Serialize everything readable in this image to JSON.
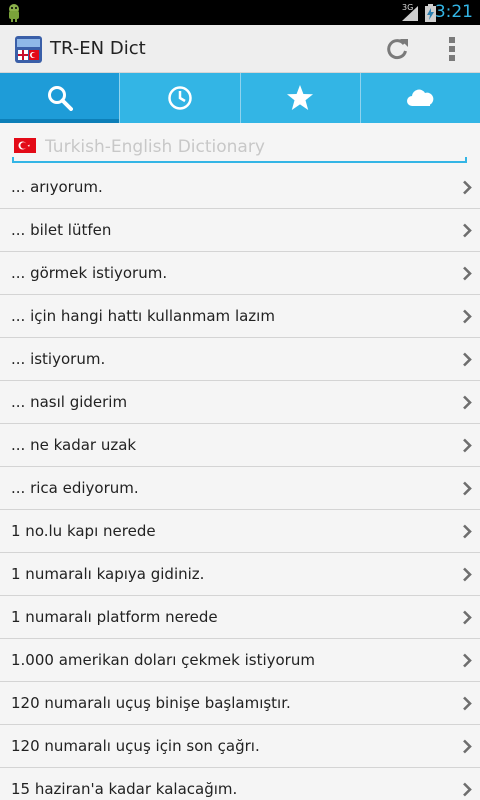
{
  "status_bar": {
    "network": "3G",
    "time": "3:21",
    "accent_color": "#33b5e5",
    "icons": [
      "android-notification-icon",
      "signal-icon",
      "battery-charging-icon"
    ]
  },
  "action_bar": {
    "title": "TR-EN Dict",
    "icons": [
      "app-logo-icon",
      "refresh-icon",
      "overflow-menu-icon"
    ]
  },
  "tabs": [
    {
      "icon": "search-icon",
      "active": true
    },
    {
      "icon": "history-clock-icon",
      "active": false
    },
    {
      "icon": "favorites-star-icon",
      "active": false
    },
    {
      "icon": "cloud-icon",
      "active": false
    }
  ],
  "search": {
    "placeholder": "Turkish-English Dictionary",
    "value": "",
    "flag_icon": "turkey-flag-icon"
  },
  "phrases": [
    "... arıyorum.",
    "... bilet lütfen",
    "... görmek istiyorum.",
    "... için hangi hattı kullanmam lazım",
    "... istiyorum.",
    "... nasıl giderim",
    "... ne kadar uzak",
    "... rica ediyorum.",
    "1 no.lu kapı nerede",
    "1 numaralı kapıya gidiniz.",
    "1 numaralı platform nerede",
    "1.000 amerikan doları çekmek istiyorum",
    "120 numaralı uçuş binişe başlamıştır.",
    "120 numaralı uçuş için son çağrı.",
    "15 haziran'a kadar kalacağım."
  ],
  "colors": {
    "tab_bar": "#33b5e5",
    "tab_active": "#1e9cd8",
    "background": "#f5f5f5",
    "divider": "#d4d4d4"
  }
}
